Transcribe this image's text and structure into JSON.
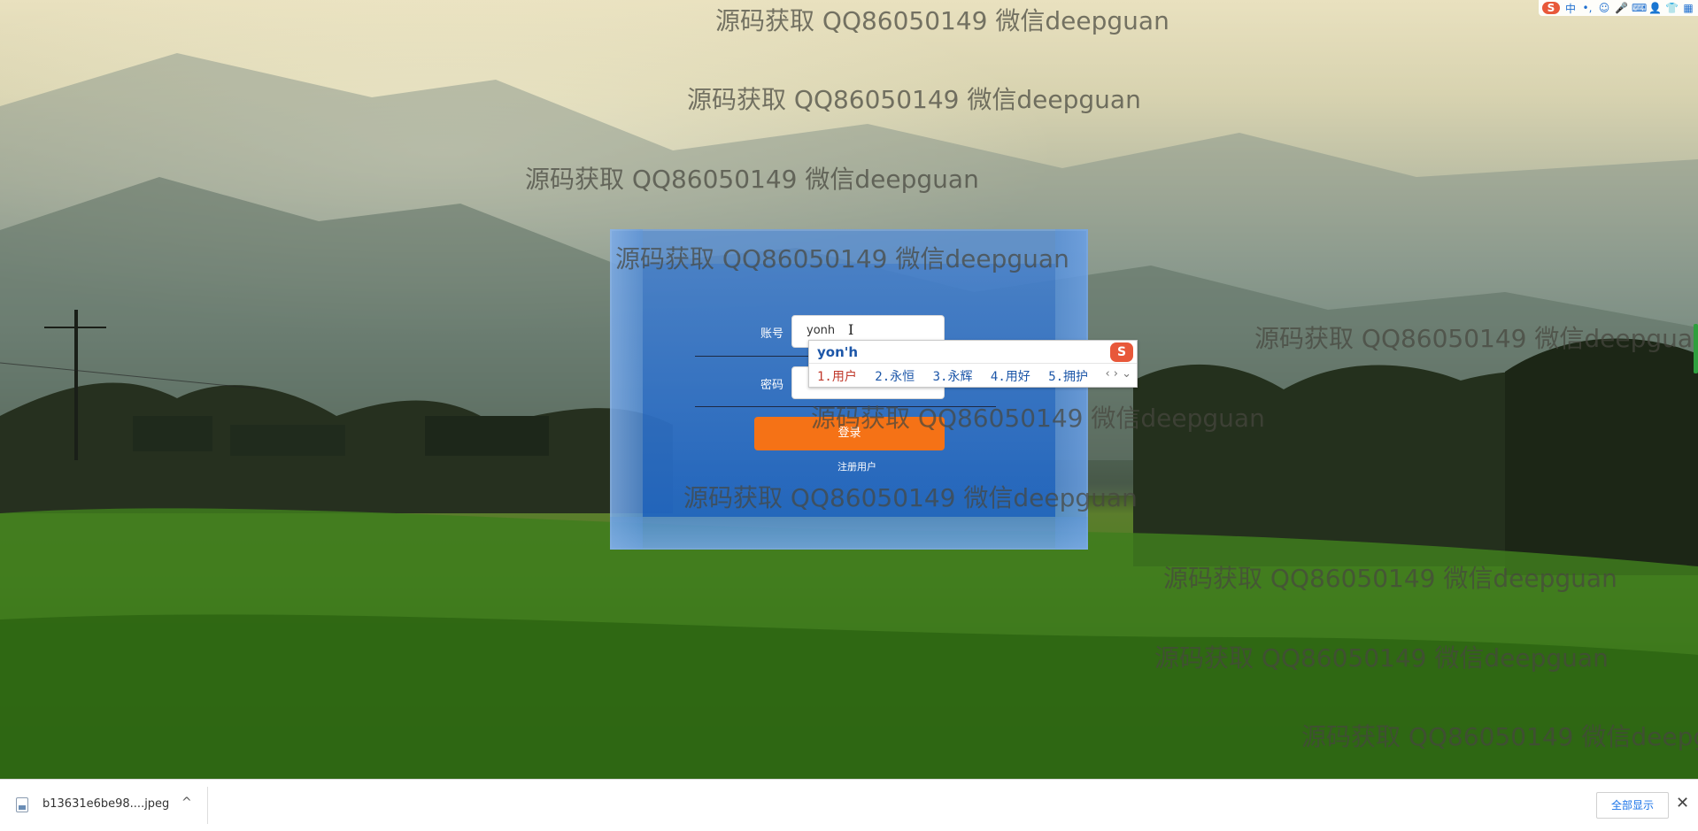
{
  "watermark_text": "源码获取 QQ86050149 微信deepguan",
  "login": {
    "account_label": "账号",
    "account_value": "yonh",
    "password_label": "密码",
    "password_value": "",
    "login_button": "登录",
    "register_link": "注册用户"
  },
  "ime": {
    "composition": "yon'h",
    "candidates": [
      "1.用户",
      "2.永恒",
      "3.永辉",
      "4.用好",
      "5.拥护"
    ],
    "logo": "S",
    "nav": "‹ › ⌄"
  },
  "ime_toolbar": {
    "items": [
      "S",
      "中",
      "•,",
      "☺",
      "🎤",
      "⌨",
      "👤",
      "👕",
      "▦"
    ]
  },
  "download_bar": {
    "file_name": "b13631e6be98....jpeg",
    "chevron": "^",
    "show_all": "全部显示",
    "close": "✕"
  },
  "colors": {
    "login_button": "#f57216",
    "panel_blue": "#3c7ad0",
    "ime_blue": "#1c56a8"
  }
}
